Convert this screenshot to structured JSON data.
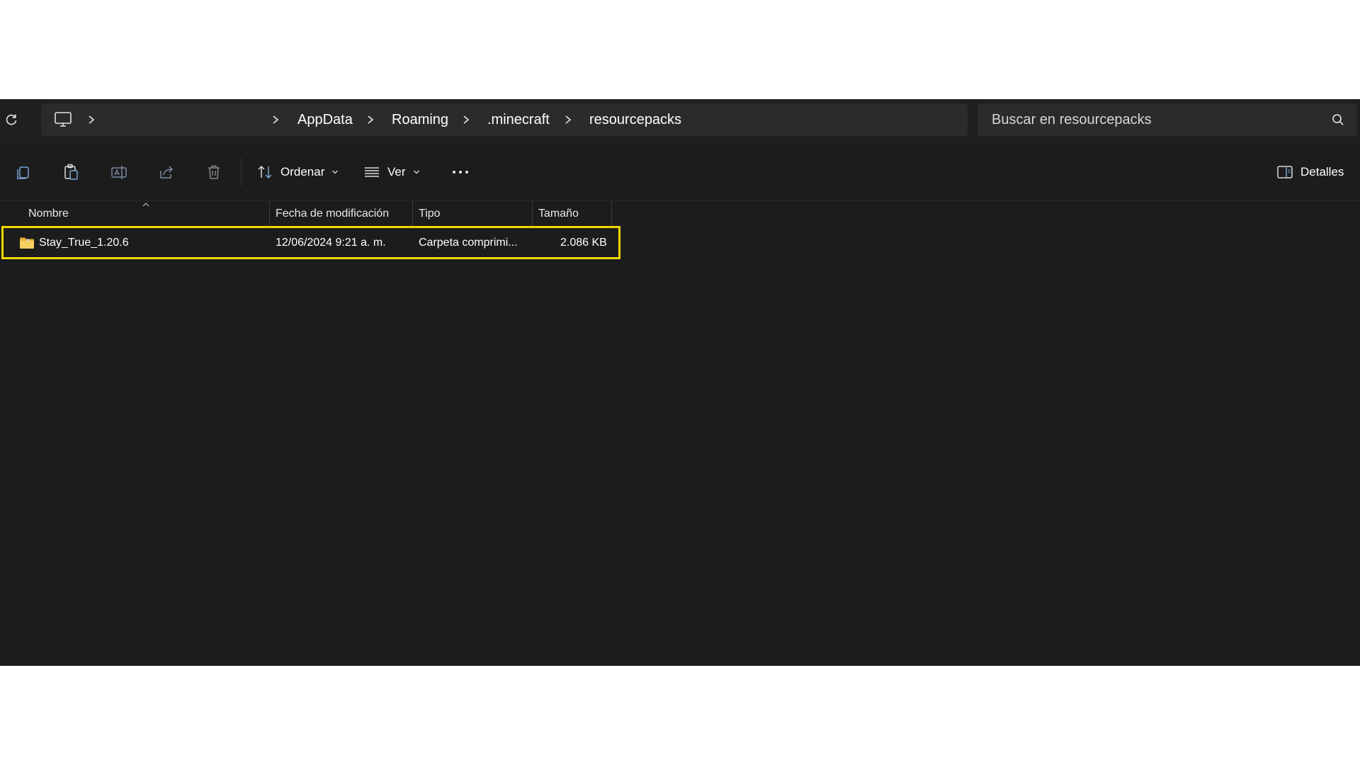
{
  "breadcrumb": {
    "items": [
      "AppData",
      "Roaming",
      ".minecraft",
      "resourcepacks"
    ]
  },
  "search": {
    "placeholder": "Buscar en resourcepacks"
  },
  "toolbar": {
    "sort_label": "Ordenar",
    "view_label": "Ver",
    "details_label": "Detalles"
  },
  "columns": {
    "name": "Nombre",
    "modified": "Fecha de modificación",
    "type": "Tipo",
    "size": "Tamaño"
  },
  "files": [
    {
      "name": "Stay_True_1.20.6",
      "modified": "12/06/2024 9:21 a. m.",
      "type": "Carpeta comprimi...",
      "size": "2.086 KB"
    }
  ],
  "colors": {
    "window_bg": "#1c1c1c",
    "highlight": "#f2d600",
    "folder": "#f0c24a"
  }
}
